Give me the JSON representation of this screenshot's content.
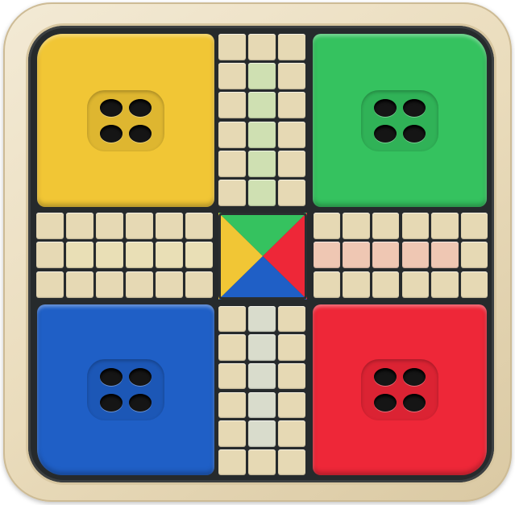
{
  "game": {
    "name": "ludo-board",
    "colors": {
      "frame": "#eadcbc",
      "board": "#262a2c",
      "cell": "#e6d9b4",
      "yellow": "#f1c635",
      "green": "#35c25f",
      "blue": "#1f5fc6",
      "red": "#ee2738",
      "path_tint_green": "#cfe0b2",
      "path_tint_blue": "#d9dccc",
      "path_tint_red": "#efc7b3",
      "path_tint_yellow": "#e9dfb6"
    },
    "home_bases": [
      {
        "color": "yellow",
        "position": "top-left",
        "hole_count": 4
      },
      {
        "color": "green",
        "position": "top-right",
        "hole_count": 4
      },
      {
        "color": "blue",
        "position": "bottom-left",
        "hole_count": 4
      },
      {
        "color": "red",
        "position": "bottom-right",
        "hole_count": 4
      }
    ],
    "track": {
      "arms": 4,
      "columns_per_arm": 3,
      "rows_per_arm": 6
    },
    "center": {
      "triangles": [
        "green",
        "red",
        "blue",
        "yellow"
      ]
    }
  }
}
